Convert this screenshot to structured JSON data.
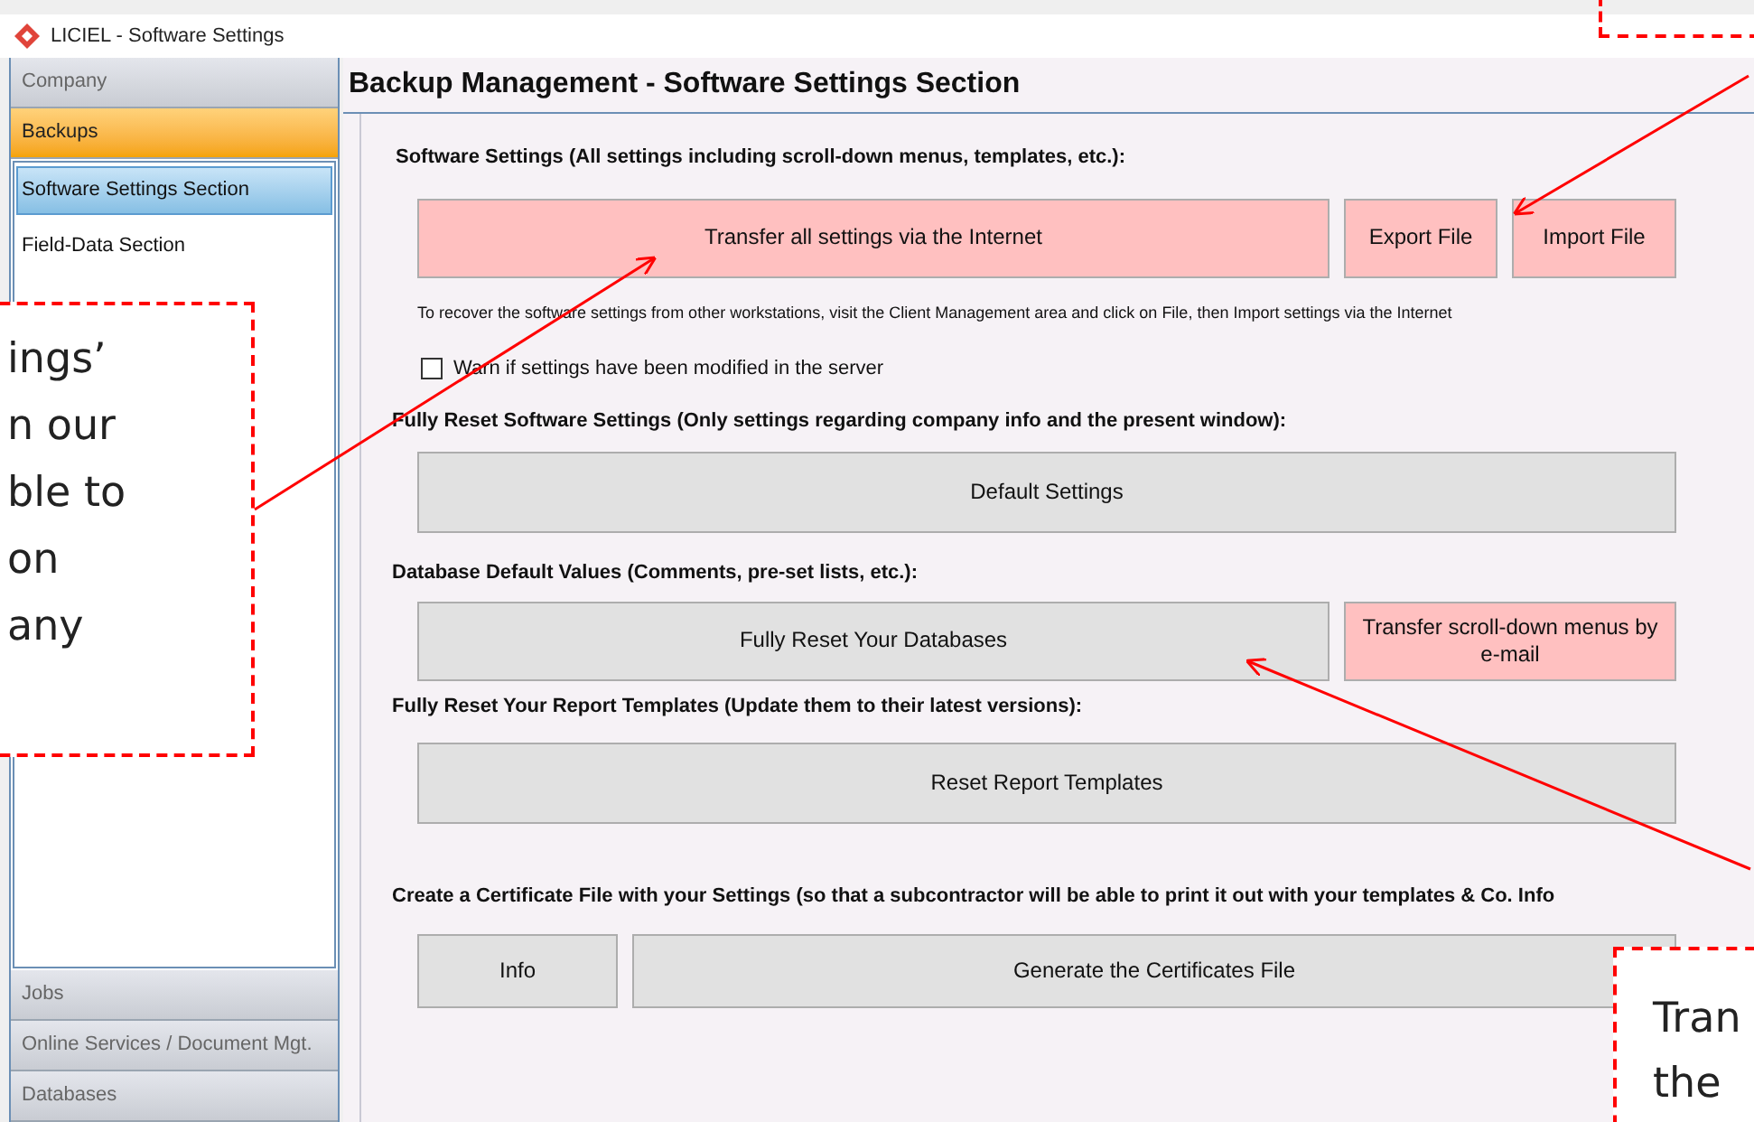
{
  "window": {
    "title": "LICIEL - Software Settings"
  },
  "sidebar": {
    "top_groups": [
      {
        "label": "Company",
        "selected": false
      },
      {
        "label": "Backups",
        "selected": true
      }
    ],
    "items": [
      {
        "label": "Software Settings Section",
        "selected": true
      },
      {
        "label": "Field-Data Section",
        "selected": false
      }
    ],
    "bottom_groups": [
      {
        "label": "Jobs",
        "selected": false
      },
      {
        "label": "Online Services / Document Mgt.",
        "selected": false
      },
      {
        "label": "Databases",
        "selected": false
      }
    ]
  },
  "heading": "Backup Management - Software Settings Section",
  "sections": [
    {
      "label": "Software Settings (All settings including scroll-down menus, templates, etc.):",
      "buttons": [
        {
          "label": "Transfer all settings via the Internet",
          "color": "#ffc0c0"
        },
        {
          "label": "Export File",
          "color": "#ffc0c0"
        },
        {
          "label": "Import File",
          "color": "#ffc0c0"
        }
      ],
      "note": "To recover the software settings from other workstations, visit the Client Management area and click on File, then Import settings via the Internet",
      "checkbox": {
        "label": "Warn if settings have been modified in the server",
        "checked": false
      }
    },
    {
      "label": "Fully Reset Software Settings (Only settings regarding company info and the present window):",
      "buttons": [
        {
          "label": "Default Settings",
          "color": "#e1e1e1"
        }
      ]
    },
    {
      "label": "Database Default Values (Comments, pre-set lists, etc.):",
      "buttons": [
        {
          "label": "Fully Reset Your Databases",
          "color": "#e1e1e1"
        },
        {
          "label": "Transfer scroll-down menus by e-mail",
          "color": "#ffc0c0"
        }
      ]
    },
    {
      "label": "Fully Reset Your Report Templates (Update them to their latest versions):",
      "buttons": [
        {
          "label": "Reset Report Templates",
          "color": "#e1e1e1"
        }
      ]
    },
    {
      "label": "Create a Certificate File with your Settings (so that a subcontractor will be able to print it out with your templates & Co. Info",
      "buttons": [
        {
          "label": "Info",
          "color": "#e1e1e1"
        },
        {
          "label": "Generate the Certificates File",
          "color": "#e1e1e1"
        }
      ]
    }
  ],
  "callouts": [
    {
      "lines": [
        "ings’",
        "n our",
        "ble to",
        "on",
        "any"
      ]
    },
    {
      "lines": [
        "Tran",
        "the"
      ]
    }
  ]
}
